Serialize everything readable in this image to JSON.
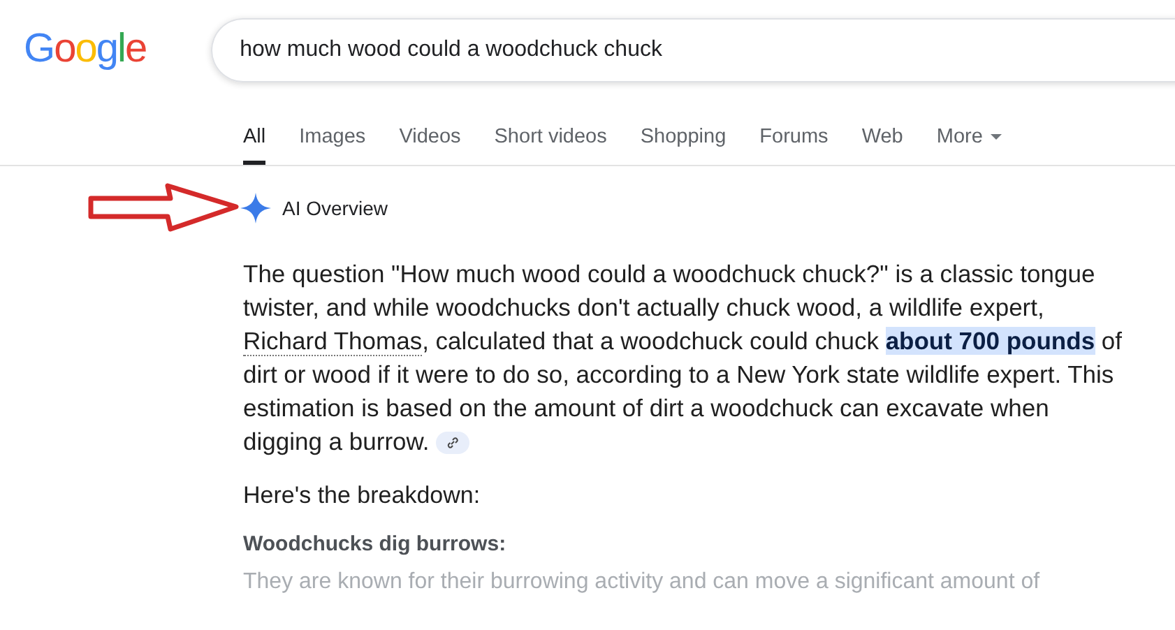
{
  "header": {
    "logo": "Google",
    "search": {
      "value": "how much wood could a woodchuck chuck"
    }
  },
  "tabs": [
    {
      "label": "All",
      "selected": true,
      "kind": "plain"
    },
    {
      "label": "Images",
      "selected": false,
      "kind": "plain"
    },
    {
      "label": "Videos",
      "selected": false,
      "kind": "plain"
    },
    {
      "label": "Short videos",
      "selected": false,
      "kind": "plain"
    },
    {
      "label": "Shopping",
      "selected": false,
      "kind": "plain"
    },
    {
      "label": "Forums",
      "selected": false,
      "kind": "plain"
    },
    {
      "label": "Web",
      "selected": false,
      "kind": "plain"
    },
    {
      "label": "More",
      "selected": false,
      "kind": "menu"
    }
  ],
  "overview": {
    "title": "AI Overview",
    "paragraph": [
      {
        "kind": "plain",
        "text": "The question \"How much wood could a woodchuck chuck?\" is a classic tongue twister, and while woodchucks don't actually chuck wood, a wildlife expert, "
      },
      {
        "kind": "link",
        "text": "Richard Thomas"
      },
      {
        "kind": "plain",
        "text": ", calculated that a woodchuck could chuck "
      },
      {
        "kind": "highlight",
        "text": "about 700 pounds"
      },
      {
        "kind": "plain",
        "text": " of dirt or wood if it were to do so, according to a New York state wildlife expert. This estimation is based on the amount of dirt a woodchuck can excavate when digging a burrow."
      }
    ],
    "heading": "Here's the breakdown:",
    "subheading": "Woodchucks dig burrows:",
    "faded_text": "They are known for their burrowing activity and can move a significant amount of"
  }
}
